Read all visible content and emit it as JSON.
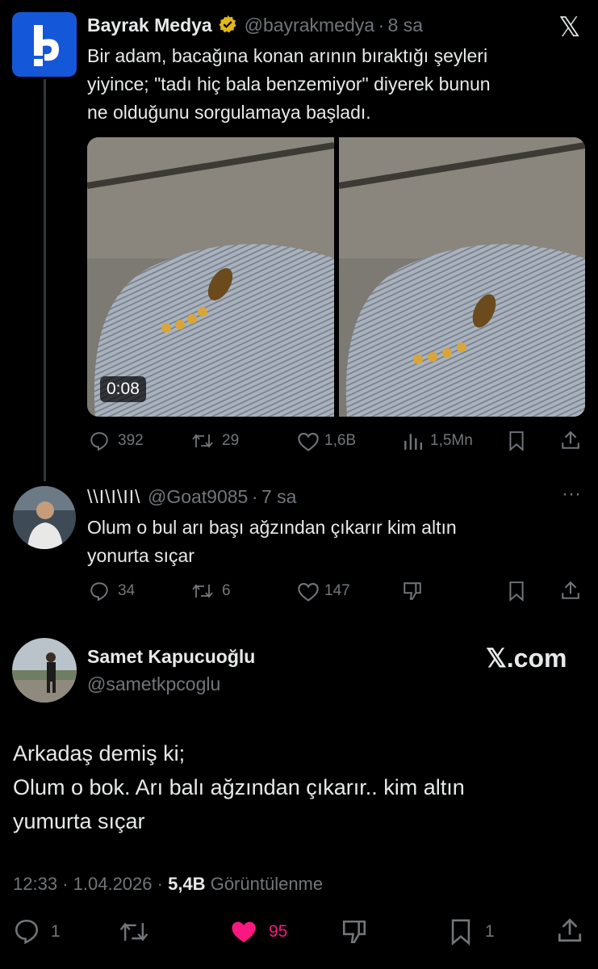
{
  "tweet1": {
    "display_name": "Bayrak Medya",
    "handle": "@bayrakmedya",
    "time": "8 sa",
    "text_lines": [
      "Bir adam, bacağına konan arının bıraktığı şeyleri",
      "yiyince; \"tadı hiç bala benzemiyor\" diyerek bunun",
      "ne olduğunu sorgulamaya başladı."
    ],
    "video_duration": "0:08",
    "stats": {
      "replies": "392",
      "reposts": "29",
      "likes": "1,6B",
      "views": "1,5Mn"
    },
    "close_glyph": "𝕏"
  },
  "reply": {
    "display_name": "\\\\I\\I\\II\\",
    "handle": "@Goat9085",
    "time": "7 sa",
    "more": "···",
    "text_lines": [
      "Olum o bul arı başı ağzından çıkarır kim altın",
      "yonurta sıçar"
    ],
    "stats": {
      "replies": "34",
      "reposts": "6",
      "likes": "147"
    }
  },
  "main": {
    "display_name": "Samet Kapucuoğlu",
    "handle": "@sametkpcoglu",
    "brand": "𝕏.com",
    "text_lines": [
      "Arkadaş demiş ki;",
      "Olum o bok. Arı balı ağzından çıkarır.. kim altın",
      "yumurta sıçar"
    ],
    "time": "12:33",
    "date": "1.04.2026",
    "views_count": "5,4B",
    "views_label": "Görüntülenme",
    "stats": {
      "replies": "1",
      "likes": "95",
      "bookmarks": "1"
    },
    "like_color": "#f91880"
  },
  "colors": {
    "background": "#000000",
    "text": "#e7e9ea",
    "muted": "#71767b",
    "verified": "#e2b719",
    "logo": "#1457d8"
  }
}
